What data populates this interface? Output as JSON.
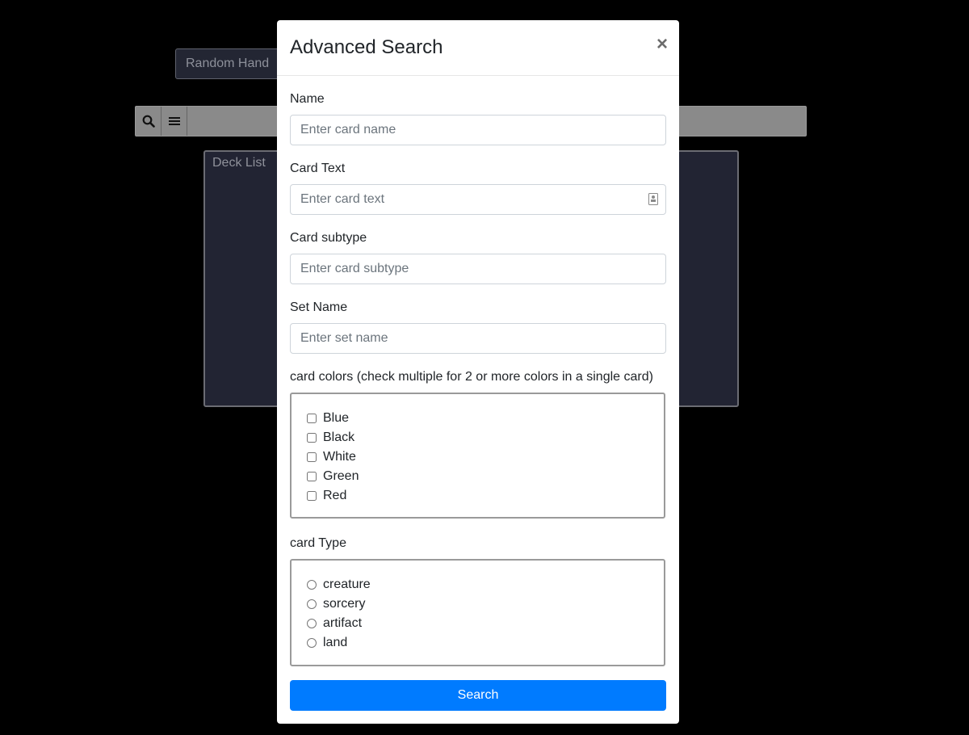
{
  "background": {
    "random_hand_label": "Random Hand",
    "toolbar": {
      "search_icon": "search-icon",
      "menu_icon": "hamburger-menu-icon"
    },
    "deck_list_title": "Deck List"
  },
  "modal": {
    "title": "Advanced Search",
    "close_label": "×",
    "fields": {
      "name": {
        "label": "Name",
        "placeholder": "Enter card name",
        "value": ""
      },
      "card_text": {
        "label": "Card Text",
        "placeholder": "Enter card text",
        "value": ""
      },
      "card_subtype": {
        "label": "Card subtype",
        "placeholder": "Enter card subtype",
        "value": ""
      },
      "set_name": {
        "label": "Set Name",
        "placeholder": "Enter set name",
        "value": ""
      }
    },
    "colors": {
      "label": "card colors (check multiple for 2 or more colors in a single card)",
      "options": [
        "Blue",
        "Black",
        "White",
        "Green",
        "Red"
      ]
    },
    "types": {
      "label": "card Type",
      "options": [
        "creature",
        "sorcery",
        "artifact",
        "land"
      ]
    },
    "search_button": "Search"
  },
  "colors": {
    "primary": "#007bff",
    "overlay": "#000000"
  }
}
